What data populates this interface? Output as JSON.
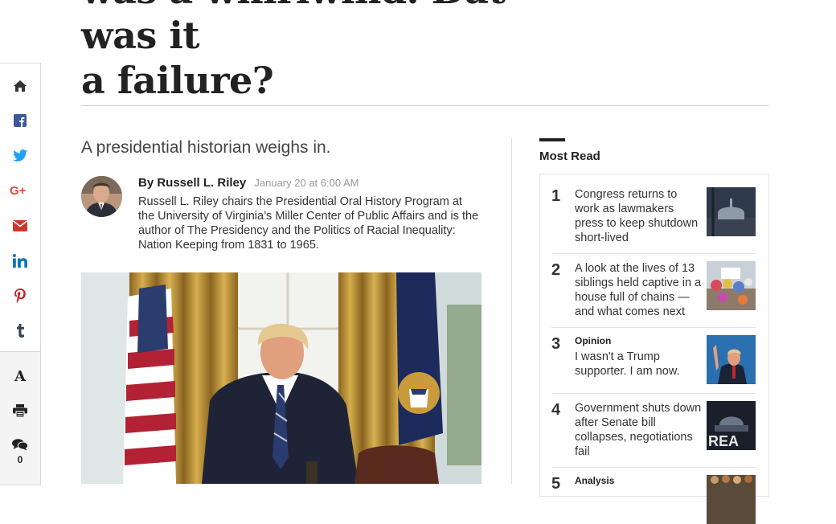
{
  "article": {
    "headline_line1": "was a whirlwind. But was it",
    "headline_line2": "a failure?",
    "subhead": "A presidential historian weighs in.",
    "author": "By Russell L. Riley",
    "date": "January 20 at 6:00 AM",
    "bio": "Russell L. Riley chairs the Presidential Oral History Program at the University of Virginia’s Miller Center of Public Affairs and is the author of The Presidency and the Politics of Racial Inequality: Nation Keeping from 1831 to 1965."
  },
  "share_rail": {
    "icons": [
      "home-icon",
      "facebook-icon",
      "twitter-icon",
      "google-plus-icon",
      "email-icon",
      "linkedin-icon",
      "pinterest-icon",
      "tumblr-icon"
    ],
    "tools": {
      "resize_text_label": "A",
      "print_icon": "print-icon",
      "comments_icon": "comments-icon",
      "comment_count": "0"
    }
  },
  "most_read": {
    "title": "Most Read",
    "items": [
      {
        "num": "1",
        "kicker": "",
        "text": "Congress returns to work as lawmakers press to keep shutdown short-lived"
      },
      {
        "num": "2",
        "kicker": "",
        "text": "A look at the lives of 13 siblings held captive in a house full of chains — and what comes next"
      },
      {
        "num": "3",
        "kicker": "Opinion",
        "text": "I wasn't a Trump supporter. I am now."
      },
      {
        "num": "4",
        "kicker": "",
        "text": "Government shuts down after Senate bill collapses, negotiations fail"
      },
      {
        "num": "5",
        "kicker": "Analysis",
        "text": ""
      }
    ]
  },
  "colors": {
    "text": "#222222",
    "facebook": "#3b5998",
    "twitter": "#1da1f2",
    "google_plus": "#dd4b39",
    "email": "#d0382b",
    "linkedin": "#0077b5",
    "pinterest": "#cb2027",
    "tumblr": "#35465c"
  }
}
